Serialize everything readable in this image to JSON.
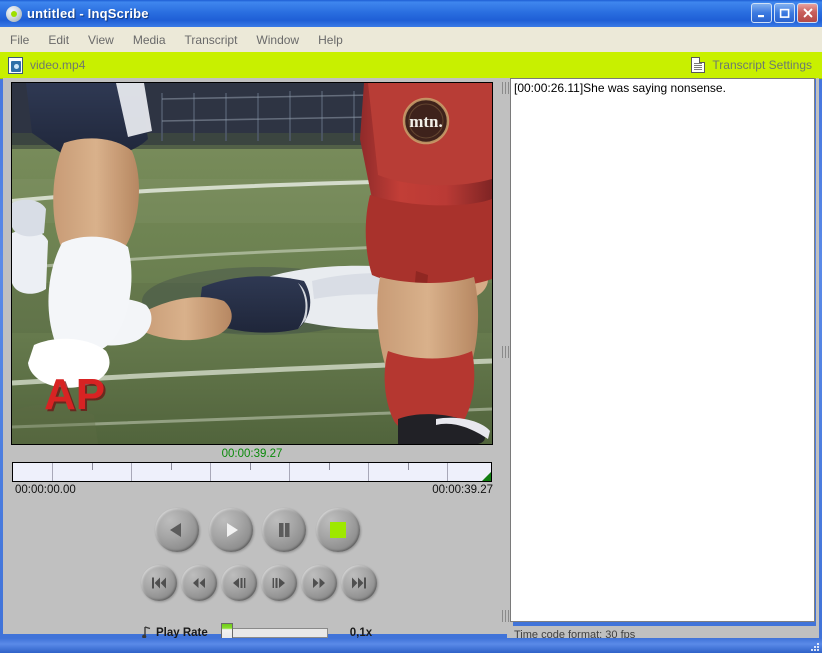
{
  "window": {
    "title": "untitled - InqScribe",
    "app_icon": "inqscribe-logo-icon",
    "buttons": {
      "minimize": "minimize-button",
      "maximize": "maximize-button",
      "close": "close-button"
    }
  },
  "menubar": {
    "items": [
      {
        "label": "File"
      },
      {
        "label": "Edit"
      },
      {
        "label": "View"
      },
      {
        "label": "Media"
      },
      {
        "label": "Transcript"
      },
      {
        "label": "Window"
      },
      {
        "label": "Help"
      }
    ]
  },
  "mediabar": {
    "media_icon": "media-file-icon",
    "media_name": "video.mp4",
    "settings_icon": "document-icon",
    "settings_label": "Transcript Settings",
    "background_color": "#c8f000"
  },
  "player": {
    "current_timecode": "00:00:39.27",
    "current_timecode_color": "#0a8a0a",
    "start_timecode": "00:00:00.00",
    "end_timecode": "00:00:39.27",
    "scrubber_position_percent": 100,
    "video": {
      "description": "Soccer match video frame: a player in white shirt and dark blue shorts lying face-down on green grass while another player in red kit stands in the foreground",
      "watermark": "AP",
      "jersey_logo": "mtn."
    },
    "transport": {
      "row1": [
        {
          "name": "reverse-play-button",
          "glyph": "play-reverse-icon"
        },
        {
          "name": "play-button",
          "glyph": "play-icon"
        },
        {
          "name": "pause-button",
          "glyph": "pause-icon"
        },
        {
          "name": "stop-button",
          "glyph": "stop-icon",
          "active_color": "#9ee800"
        }
      ],
      "row2": [
        {
          "name": "skip-to-start-button",
          "glyph": "skip-start-icon"
        },
        {
          "name": "rewind-button",
          "glyph": "rewind-icon"
        },
        {
          "name": "step-back-button",
          "glyph": "step-back-icon"
        },
        {
          "name": "step-forward-button",
          "glyph": "step-forward-icon"
        },
        {
          "name": "fast-forward-button",
          "glyph": "fast-forward-icon"
        },
        {
          "name": "skip-to-end-button",
          "glyph": "skip-end-icon"
        }
      ]
    },
    "play_rate": {
      "icon": "play-rate-icon",
      "label": "Play Rate",
      "value": "0,1x",
      "slider_position_percent": 2
    }
  },
  "transcript": {
    "text": "[00:00:26.11]She was saying nonsense."
  },
  "statusbar": {
    "text": "Time code format: 30 fps"
  }
}
